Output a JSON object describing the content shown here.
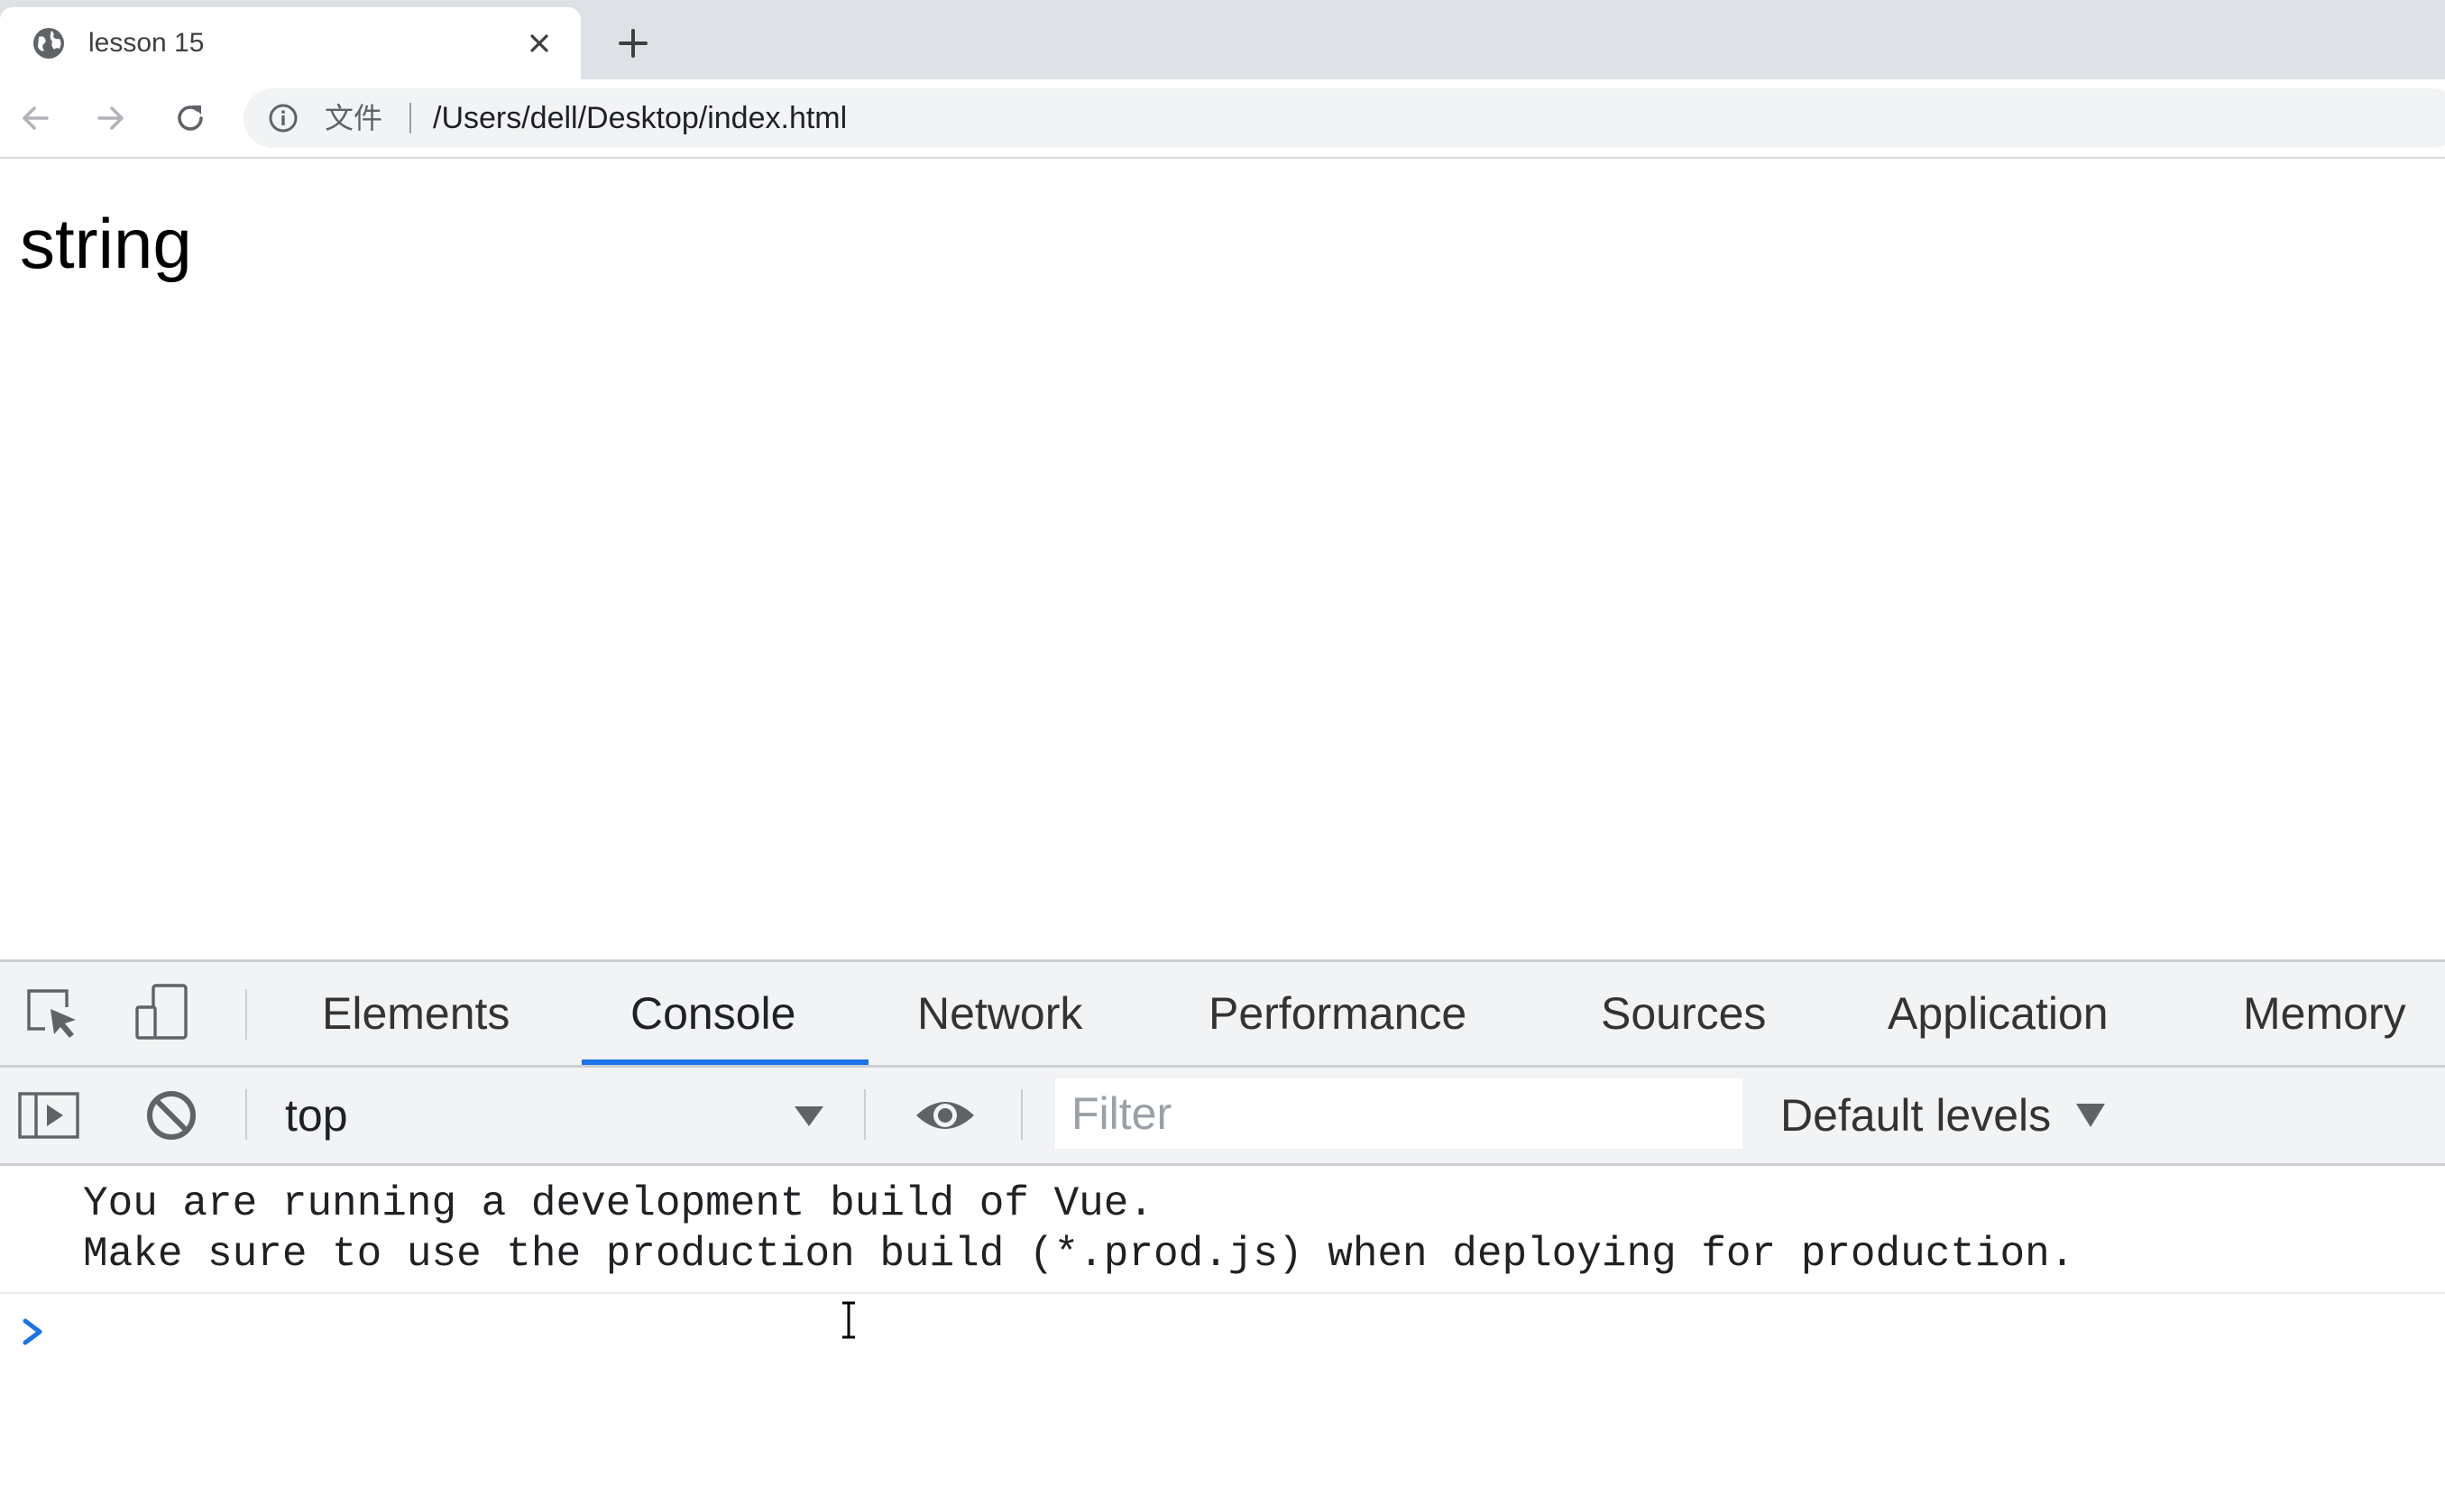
{
  "browser": {
    "tab": {
      "title": "lesson 15",
      "favicon": "globe-icon",
      "close_icon": "close-icon"
    },
    "new_tab_icon": "plus-icon",
    "toolbar": {
      "back_icon": "back-arrow-icon",
      "forward_icon": "forward-arrow-icon",
      "reload_icon": "reload-icon",
      "site_info_icon": "info-icon",
      "file_label": "文件",
      "url": "/Users/dell/Desktop/index.html"
    }
  },
  "page": {
    "content_text": "string"
  },
  "devtools": {
    "left_icons": [
      "inspect-element-icon",
      "device-toolbar-icon"
    ],
    "tabs": [
      {
        "label": "Elements"
      },
      {
        "label": "Console"
      },
      {
        "label": "Network"
      },
      {
        "label": "Performance"
      },
      {
        "label": "Sources"
      },
      {
        "label": "Application"
      },
      {
        "label": "Memory"
      }
    ],
    "active_tab": "Console",
    "accent_color": "#1a73e8",
    "console_toolbar": {
      "sidebar_icon": "show-sidebar-icon",
      "clear_icon": "clear-console-icon",
      "context": "top",
      "eye_icon": "live-expression-icon",
      "filter_placeholder": "Filter",
      "levels": "Default levels"
    },
    "console": {
      "messages": [
        "You are running a development build of Vue.",
        "Make sure to use the production build (*.prod.js) when deploying for production."
      ],
      "prompt_icon": "chevron-right-icon",
      "prompt_color": "#1a73e8"
    }
  }
}
